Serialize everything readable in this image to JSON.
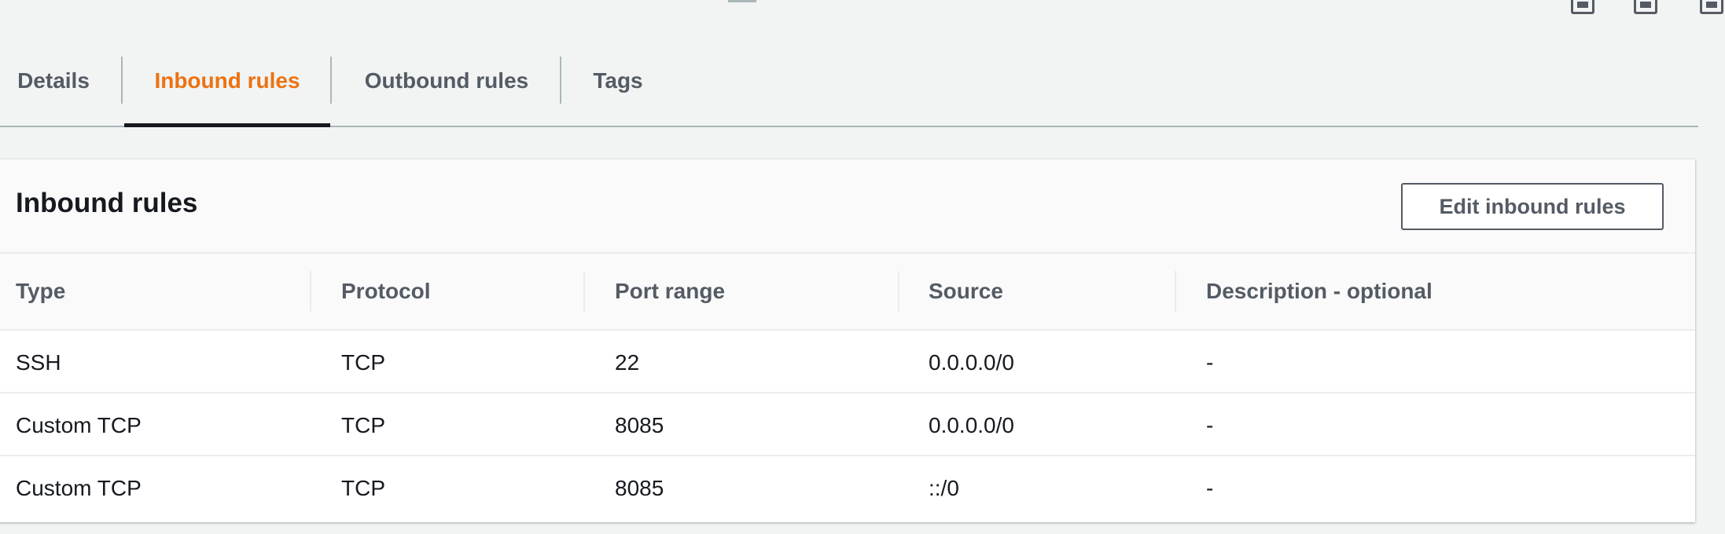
{
  "tabs": [
    {
      "label": "Details",
      "active": false
    },
    {
      "label": "Inbound rules",
      "active": true
    },
    {
      "label": "Outbound rules",
      "active": false
    },
    {
      "label": "Tags",
      "active": false
    }
  ],
  "panel": {
    "title": "Inbound rules",
    "edit_button_label": "Edit inbound rules"
  },
  "table": {
    "columns": [
      "Type",
      "Protocol",
      "Port range",
      "Source",
      "Description - optional"
    ],
    "rows": [
      [
        "SSH",
        "TCP",
        "22",
        "0.0.0.0/0",
        "-"
      ],
      [
        "Custom TCP",
        "TCP",
        "8085",
        "0.0.0.0/0",
        "-"
      ],
      [
        "Custom TCP",
        "TCP",
        "8085",
        "::/0",
        "-"
      ]
    ]
  },
  "colors": {
    "active_tab": "#ec7211",
    "inactive_tab": "#545b64",
    "text": "#16191f",
    "border": "#eaeded",
    "background": "#f2f3f3"
  },
  "icons": [
    "panel-bottom-icon",
    "panel-bottom-icon",
    "panel-side-icon"
  ]
}
